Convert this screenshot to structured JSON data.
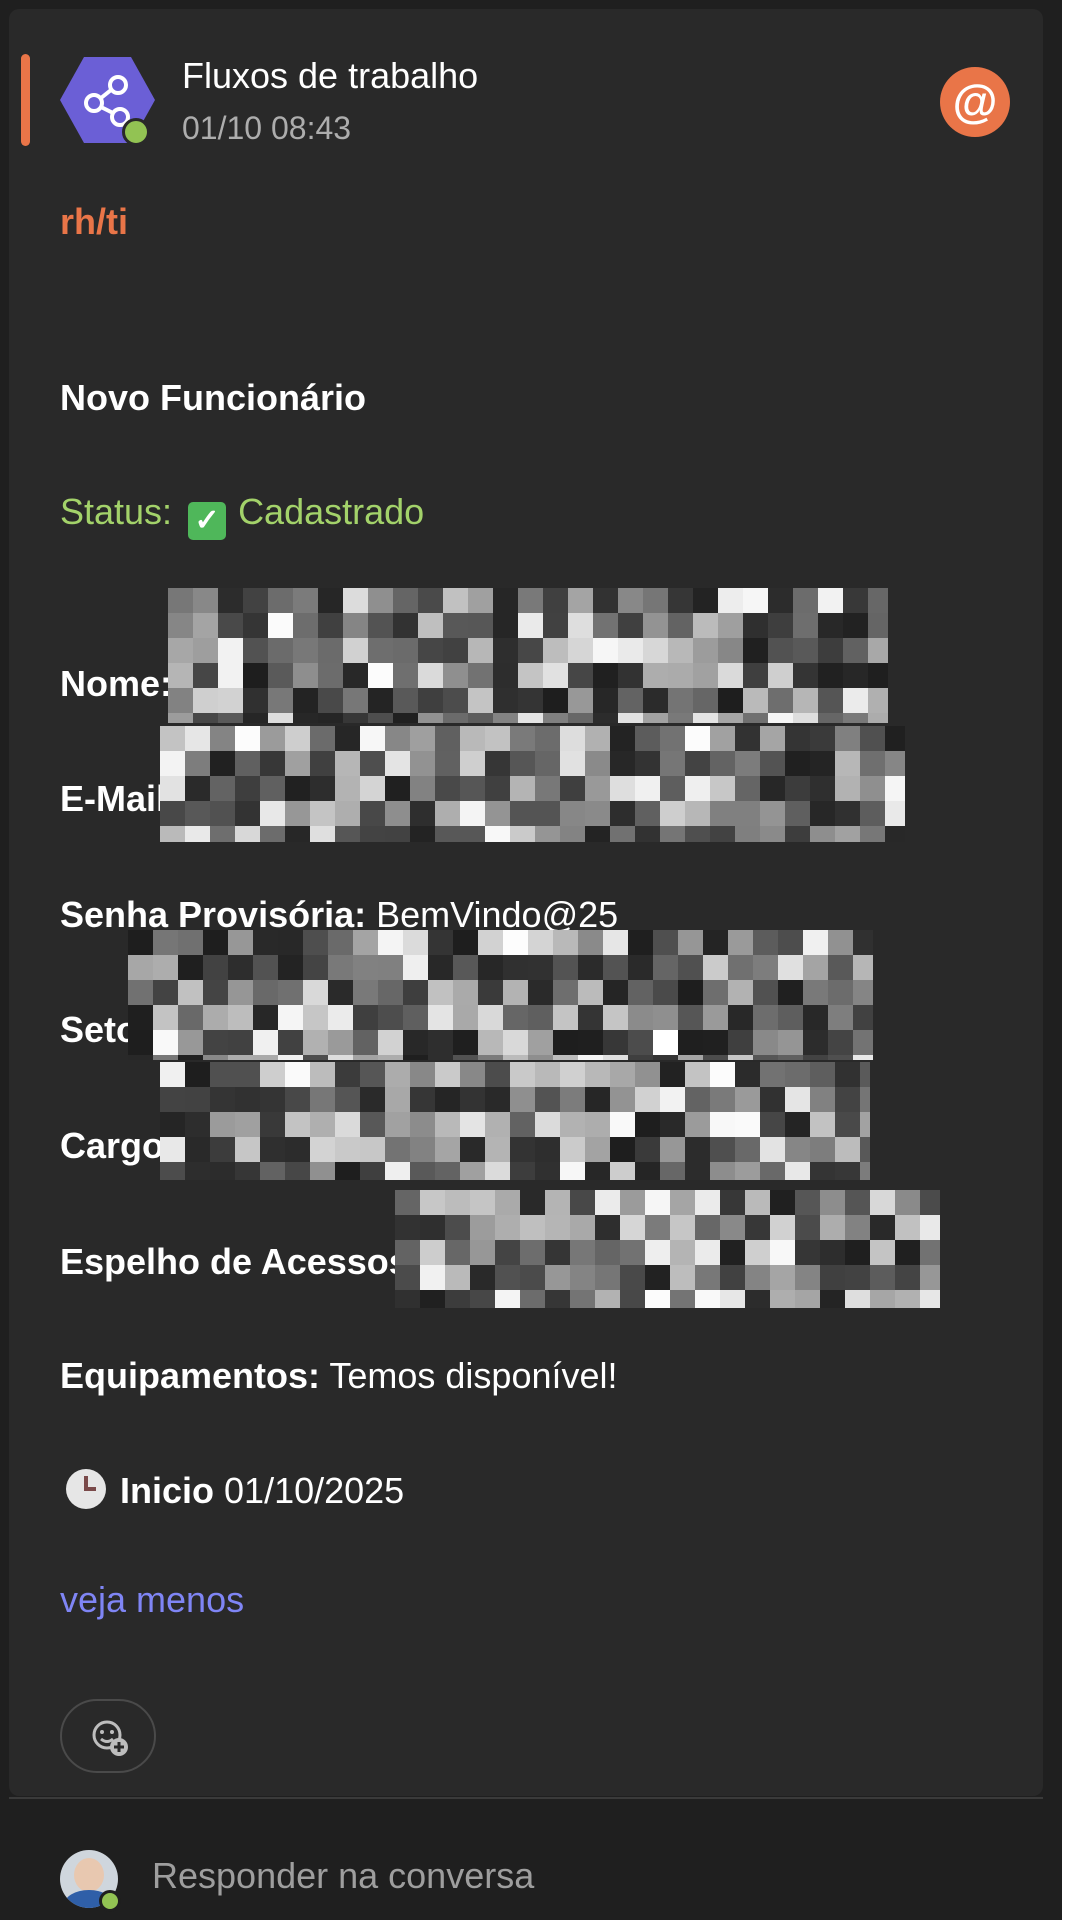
{
  "message": {
    "sender": "Fluxos de trabalho",
    "timestamp": "01/10 08:43",
    "mention_symbol": "@",
    "tag": "rh/ti"
  },
  "card": {
    "title": "Novo Funcionário",
    "status_label": "Status:",
    "status_value": "Cadastrado",
    "fields": [
      {
        "label": "Nome:",
        "value": ""
      },
      {
        "label": "E-Mail:",
        "value": ""
      },
      {
        "label": "Senha Provisória:",
        "value": "BemVindo@25"
      },
      {
        "label": "Setor:",
        "value": ""
      },
      {
        "label": "Cargo:",
        "value": ""
      },
      {
        "label": "Espelho de Acessos:",
        "value": ""
      },
      {
        "label": "Equipamentos:",
        "value": "Temos disponível!"
      }
    ],
    "start_label": "Inicio",
    "start_date": "01/10/2025",
    "toggle_link": "veja menos"
  },
  "reply": {
    "placeholder": "Responder na conversa"
  },
  "colors": {
    "accent": "#e97548",
    "status_green": "#a3d26a",
    "link": "#7f85f5",
    "app_icon": "#6b5fd6"
  },
  "icons": {
    "app": "workflow-share-icon",
    "mention": "mention-at-icon",
    "status": "check-box-icon",
    "start": "clock-icon",
    "reaction": "add-reaction-icon"
  }
}
